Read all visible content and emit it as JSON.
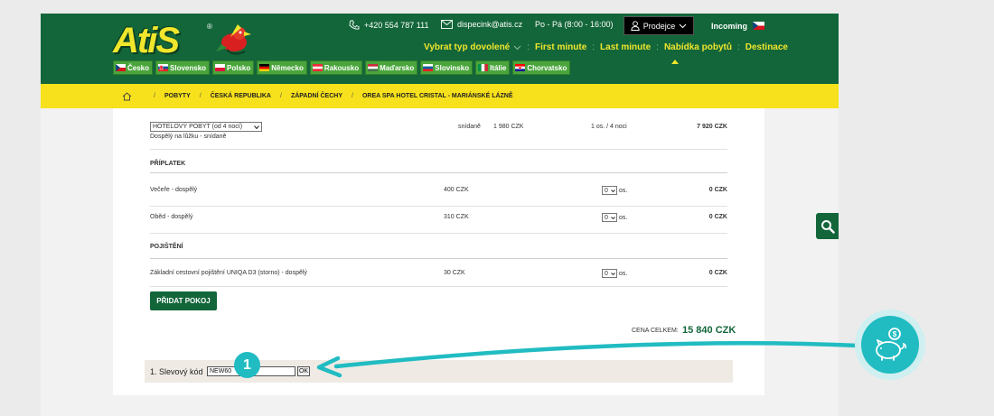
{
  "header": {
    "logo": "AtiS",
    "logo_reg": "®",
    "phone": "+420 554 787 111",
    "email": "dispecink@atis.cz",
    "hours": "Po - Pá (8:00 - 16:00)",
    "seller": "Prodejce",
    "incoming": "Incoming"
  },
  "nav": {
    "items": [
      "Vybrat typ dovolené",
      "First minute",
      "Last minute",
      "Nabídka pobytů",
      "Destinace"
    ]
  },
  "countries": [
    "Česko",
    "Slovensko",
    "Polsko",
    "Německo",
    "Rakousko",
    "Maďarsko",
    "Slovinsko",
    "Itálie",
    "Chorvatsko"
  ],
  "breadcrumb": [
    "POBYTY",
    "ČESKÁ REPUBLIKA",
    "ZÁPADNÍ ČECHY",
    "OREA SPA HOTEL CRISTAL - MARIÁNSKÉ LÁZNĚ"
  ],
  "package": {
    "select": "HOTELOVÝ POBYT (od 4 nocí)",
    "desc": "Dospělý na lůžku - snídaně",
    "board": "snídaně",
    "price": "1 980 CZK",
    "persons": "1 os. / 4 noci",
    "total": "7 920 CZK"
  },
  "surcharge": {
    "title": "PŘÍPLATEK",
    "items": [
      {
        "name": "Večeře - dospělý",
        "price": "400 CZK",
        "qty": "0",
        "unit": "os.",
        "total": "0 CZK"
      },
      {
        "name": "Oběd - dospělý",
        "price": "310 CZK",
        "qty": "0",
        "unit": "os.",
        "total": "0 CZK"
      }
    ]
  },
  "insurance": {
    "title": "POJIŠTĚNÍ",
    "items": [
      {
        "name": "Základní cestovní pojištění UNIQA D3 (storno) - dospělý",
        "price": "30 CZK",
        "qty": "0",
        "unit": "os.",
        "total": "0 CZK"
      }
    ]
  },
  "add_room": "PŘIDAT POKOJ",
  "total": {
    "label": "CENA CELKEM:",
    "value": "15 840 CZK"
  },
  "discount": {
    "label": "1. Slevový kód",
    "code": "NEW60",
    "ok": "OK"
  },
  "annotation": {
    "step": "1"
  },
  "colors": {
    "brand_green": "#13663a",
    "brand_yellow": "#f7e11c",
    "accent_teal": "#21bcc2"
  }
}
